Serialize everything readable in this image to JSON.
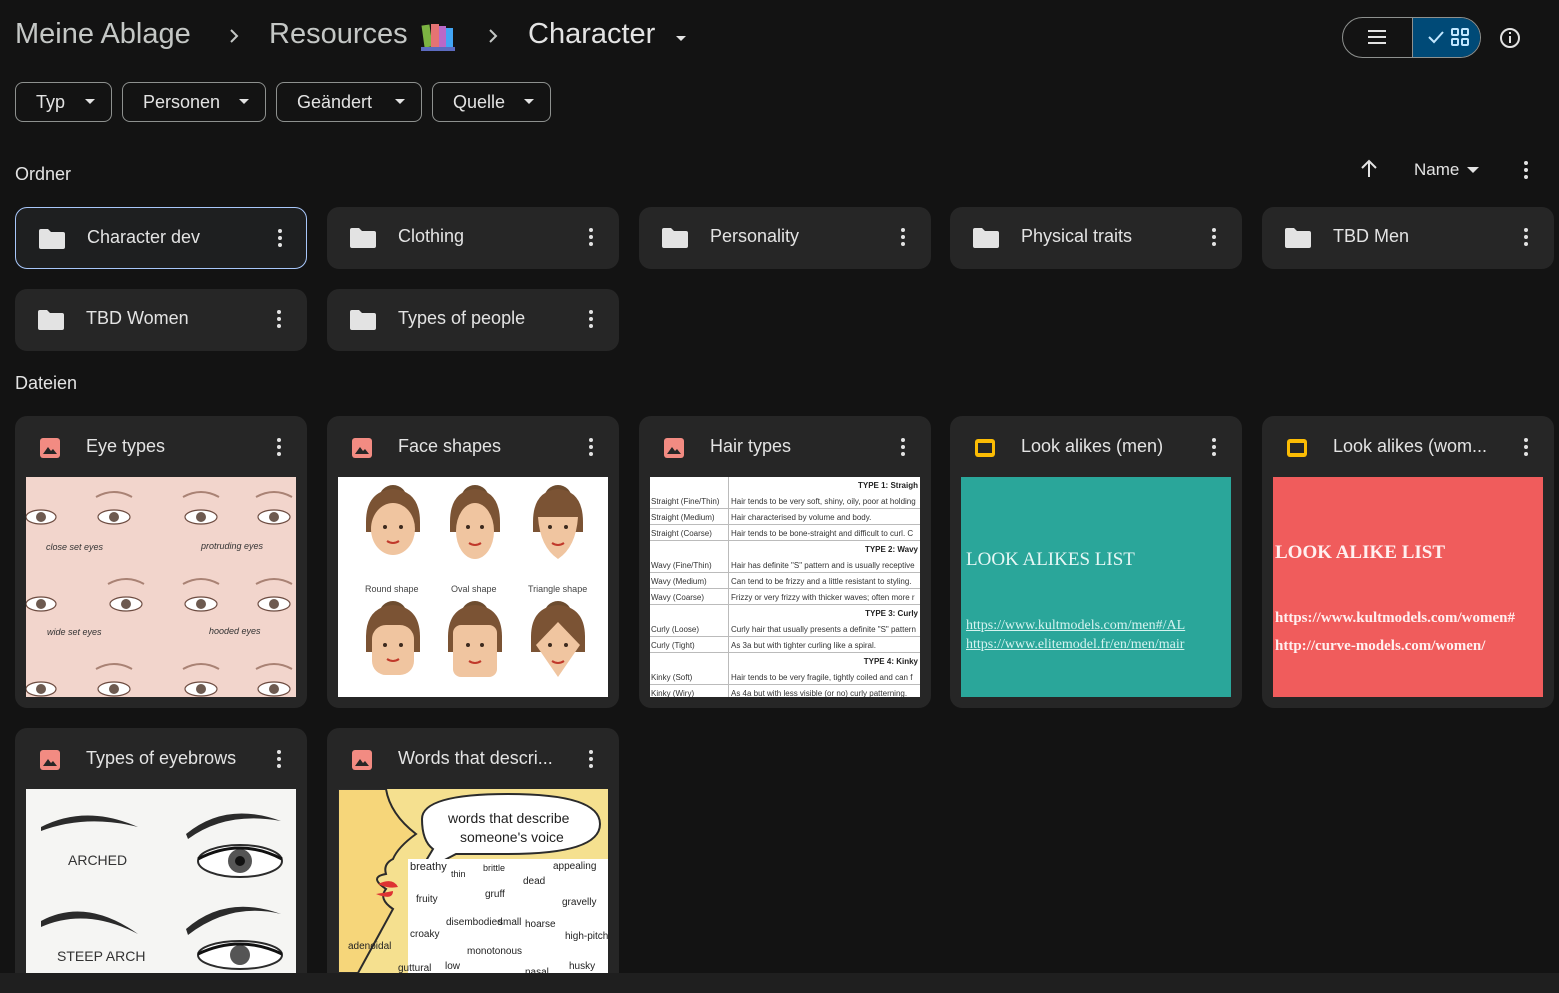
{
  "breadcrumb": {
    "root": "Meine Ablage",
    "parent": "Resources",
    "current": "Character"
  },
  "filters": [
    "Typ",
    "Personen",
    "Geändert",
    "Quelle"
  ],
  "sections": {
    "folders_label": "Ordner",
    "files_label": "Dateien"
  },
  "sort": {
    "field": "Name",
    "direction": "ascending"
  },
  "folders": [
    {
      "name": "Character dev",
      "selected": true
    },
    {
      "name": "Clothing"
    },
    {
      "name": "Personality"
    },
    {
      "name": "Physical traits"
    },
    {
      "name": "TBD Men"
    },
    {
      "name": "TBD Women"
    },
    {
      "name": "Types of people"
    }
  ],
  "files": [
    {
      "name": "Eye types",
      "kind": "image"
    },
    {
      "name": "Face shapes",
      "kind": "image"
    },
    {
      "name": "Hair types",
      "kind": "image"
    },
    {
      "name": "Look alikes (men)",
      "kind": "slides"
    },
    {
      "name": "Look alikes (wom...",
      "kind": "slides"
    },
    {
      "name": "Types of eyebrows",
      "kind": "image"
    },
    {
      "name": "Words that descri...",
      "kind": "image"
    }
  ],
  "thumbs": {
    "eyes": [
      "close set eyes",
      "protruding eyes",
      "wide set eyes",
      "hooded eyes"
    ],
    "faces": [
      "Round shape",
      "Oval shape",
      "Triangle shape"
    ],
    "hair": {
      "type1": "TYPE 1: Straigh",
      "type2": "TYPE 2: Wavy",
      "type3": "TYPE 3: Curly",
      "type4": "TYPE 4: Kinky",
      "rows": [
        [
          "Straight (Fine/Thin)",
          "Hair tends to be very soft, shiny, oily, poor at holding"
        ],
        [
          "Straight (Medium)",
          "Hair characterised by volume and body."
        ],
        [
          "Straight (Coarse)",
          "Hair tends to be bone-straight and difficult to curl. C"
        ],
        [
          "Wavy (Fine/Thin)",
          "Hair has definite \"S\" pattern and is usually receptive"
        ],
        [
          "Wavy (Medium)",
          "Can tend to be frizzy and a little resistant to styling."
        ],
        [
          "Wavy (Coarse)",
          "Frizzy or very frizzy with thicker waves; often more r"
        ],
        [
          "Curly (Loose)",
          "Curly hair that usually presents a definite \"S\" pattern"
        ],
        [
          "Curly (Tight)",
          "As 3a but with tighter curling like a spiral."
        ],
        [
          "Kinky (Soft)",
          "Hair tends to be very fragile, tightly coiled and can f"
        ],
        [
          "Kinky (Wiry)",
          "As 4a but with less visible (or no) curly patterning."
        ]
      ]
    },
    "lookalikes_men": {
      "title": "LOOK ALIKES LIST",
      "link1": "https://www.kultmodels.com/men#/AL",
      "link2": "https://www.elitemodel.fr/en/men/mair"
    },
    "lookalikes_women": {
      "title": "LOOK ALIKE LIST",
      "link1": "https://www.kultmodels.com/women#",
      "link2": "http://curve-models.com/women/"
    },
    "brows": [
      "ARCHED",
      "STEEP ARCH"
    ],
    "voice": {
      "title_line1": "words that describe",
      "title_line2": "someone's voice",
      "words": [
        "breathy",
        "brittle",
        "appealing",
        "thin",
        "dead",
        "gruff",
        "fruity",
        "gravelly",
        "croaky",
        "disembodied",
        "small",
        "hoarse",
        "high-pitched",
        "adenoidal",
        "monotonous",
        "low",
        "guttural",
        "husky",
        "nasal"
      ]
    }
  },
  "colors": {
    "background": "#131313",
    "tile": "#262626",
    "selected_border": "#a8c7fa",
    "grid_toggle_active": "#004a77",
    "image_icon": "#f28b82",
    "slides_icon": "#fbbc04"
  }
}
